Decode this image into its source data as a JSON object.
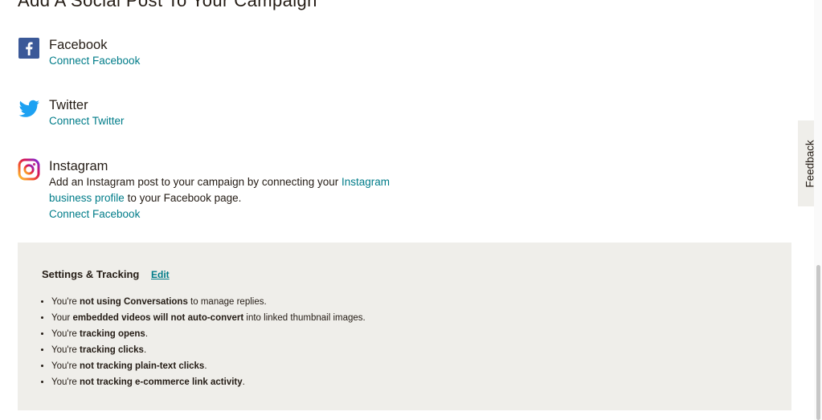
{
  "page": {
    "title": "Add A Social Post To Your Campaign"
  },
  "social": {
    "facebook": {
      "name": "Facebook",
      "link": "Connect Facebook",
      "icon": "facebook-icon",
      "color": "#3b5998"
    },
    "twitter": {
      "name": "Twitter",
      "link": "Connect Twitter",
      "icon": "twitter-icon",
      "color": "#1da1f2"
    },
    "instagram": {
      "name": "Instagram",
      "desc_prefix": "Add an Instagram post to your campaign by connecting your ",
      "desc_link": "Instagram business profile",
      "desc_suffix": " to your Facebook page.",
      "link": "Connect Facebook",
      "icon": "instagram-icon"
    }
  },
  "settings": {
    "title": "Settings & Tracking",
    "edit": "Edit",
    "items": [
      {
        "pre": "You're ",
        "bold": "not using Conversations",
        "post": " to manage replies."
      },
      {
        "pre": "Your ",
        "bold": "embedded videos will not auto-convert",
        "post": " into linked thumbnail images."
      },
      {
        "pre": "You're ",
        "bold": "tracking opens",
        "post": "."
      },
      {
        "pre": "You're ",
        "bold": "tracking clicks",
        "post": "."
      },
      {
        "pre": "You're ",
        "bold": "not tracking plain-text clicks",
        "post": "."
      },
      {
        "pre": "You're ",
        "bold": "not tracking e-commerce link activity",
        "post": "."
      }
    ]
  },
  "feedback": {
    "label": "Feedback"
  },
  "colors": {
    "link": "#007c89",
    "panel": "#efeeea",
    "text": "#241c15"
  }
}
